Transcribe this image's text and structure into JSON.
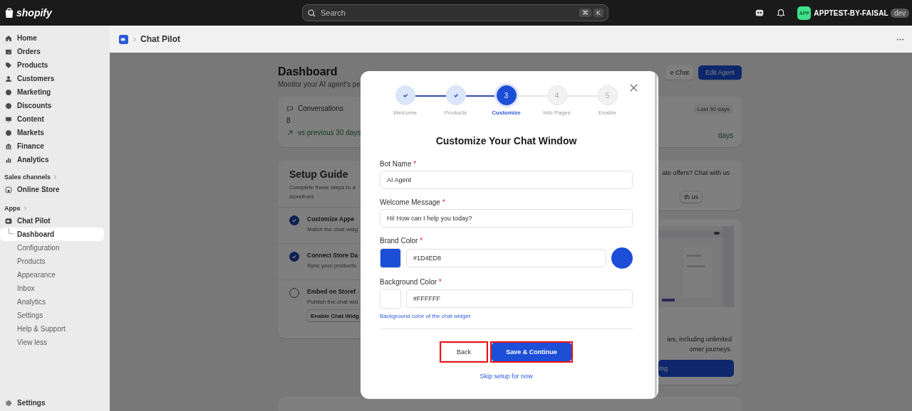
{
  "topbar": {
    "logo": "shopify",
    "search": {
      "placeholder": "Search",
      "keys": [
        "⌘",
        "K"
      ]
    },
    "store": {
      "avatar": "APP",
      "name": "APPTEST-BY-FAISAL",
      "badge": "dev"
    }
  },
  "sidebar": {
    "items": [
      {
        "label": "Home",
        "selected": false
      },
      {
        "label": "Orders",
        "selected": false
      },
      {
        "label": "Products",
        "selected": false
      },
      {
        "label": "Customers",
        "selected": false
      },
      {
        "label": "Marketing",
        "selected": false
      },
      {
        "label": "Discounts",
        "selected": false
      },
      {
        "label": "Content",
        "selected": false
      },
      {
        "label": "Markets",
        "selected": false
      },
      {
        "label": "Finance",
        "selected": false
      },
      {
        "label": "Analytics",
        "selected": false
      }
    ],
    "sales_channels": {
      "heading": "Sales channels",
      "items": [
        {
          "label": "Online Store",
          "selected": false
        }
      ]
    },
    "apps": {
      "heading": "Apps",
      "app": {
        "label": "Chat Pilot",
        "children": [
          {
            "label": "Dashboard",
            "selected": true
          },
          {
            "label": "Configuration",
            "selected": false
          },
          {
            "label": "Products",
            "selected": false
          },
          {
            "label": "Appearance",
            "selected": false
          },
          {
            "label": "Inbox",
            "selected": false
          },
          {
            "label": "Analytics",
            "selected": false
          },
          {
            "label": "Settings",
            "selected": false
          },
          {
            "label": "Help & Support",
            "selected": false
          },
          {
            "label": "View less",
            "selected": false
          }
        ]
      }
    },
    "footer": {
      "label": "Settings"
    }
  },
  "header": {
    "title": "Chat Pilot"
  },
  "dashboard": {
    "title": "Dashboard",
    "subtitle": "Monitor your AI agent's pe",
    "buttons": [
      "e Chat",
      "Edit Agent"
    ],
    "metrics": {
      "label": "Conversations",
      "value": "8",
      "trend": "vs previous 30 days",
      "period": "Last 30 days",
      "right_trend": "days"
    },
    "setup": {
      "title": "Setup Guide",
      "description": [
        "Complete these steps to a",
        "storefront."
      ],
      "tasks": [
        {
          "title": "Customize Appe",
          "description": "Match the chat widg",
          "checked": true
        },
        {
          "title": "Connect Store Da",
          "description": "Sync your products,",
          "checked": true
        },
        {
          "title": "Embed on Storef",
          "description": "Publish the chat wid",
          "checked": false,
          "button": "Enable Chat Widg"
        }
      ]
    },
    "support": {
      "text": "ate offers? Chat with us",
      "button": "th us"
    },
    "upgrade": {
      "text": [
        "ies, including unlimited",
        "omer journeys."
      ],
      "button": "ing"
    }
  },
  "modal": {
    "steps": [
      {
        "label": "Welcome",
        "completed": true,
        "selected": false
      },
      {
        "label": "Products",
        "completed": true,
        "selected": false
      },
      {
        "label": "Customize",
        "completed": false,
        "selected": true,
        "number": "3"
      },
      {
        "label": "Info Pages",
        "completed": false,
        "selected": false,
        "number": "4"
      },
      {
        "label": "Enable",
        "completed": false,
        "selected": false,
        "number": "5"
      }
    ],
    "title": "Customize Your Chat Window",
    "fields": [
      {
        "kind": "text",
        "label": "Bot Name",
        "required_mark": "*",
        "value": "AI Agent"
      },
      {
        "kind": "text",
        "label": "Welcome Message",
        "required_mark": "*",
        "value": "Hi! How can I help you today?"
      },
      {
        "kind": "color",
        "label": "Brand Color",
        "required_mark": "*",
        "value": "#1D4ED8",
        "color": "#1d4ed8",
        "preview": true
      },
      {
        "kind": "color",
        "label": "Background Color",
        "required_mark": "*",
        "value": "#FFFFFF",
        "color": "#ffffff",
        "preview": false,
        "hint": "Background color of the chat widget"
      }
    ],
    "back": "Back",
    "save": "Save & Continue",
    "skip": "Skip setup for now"
  }
}
